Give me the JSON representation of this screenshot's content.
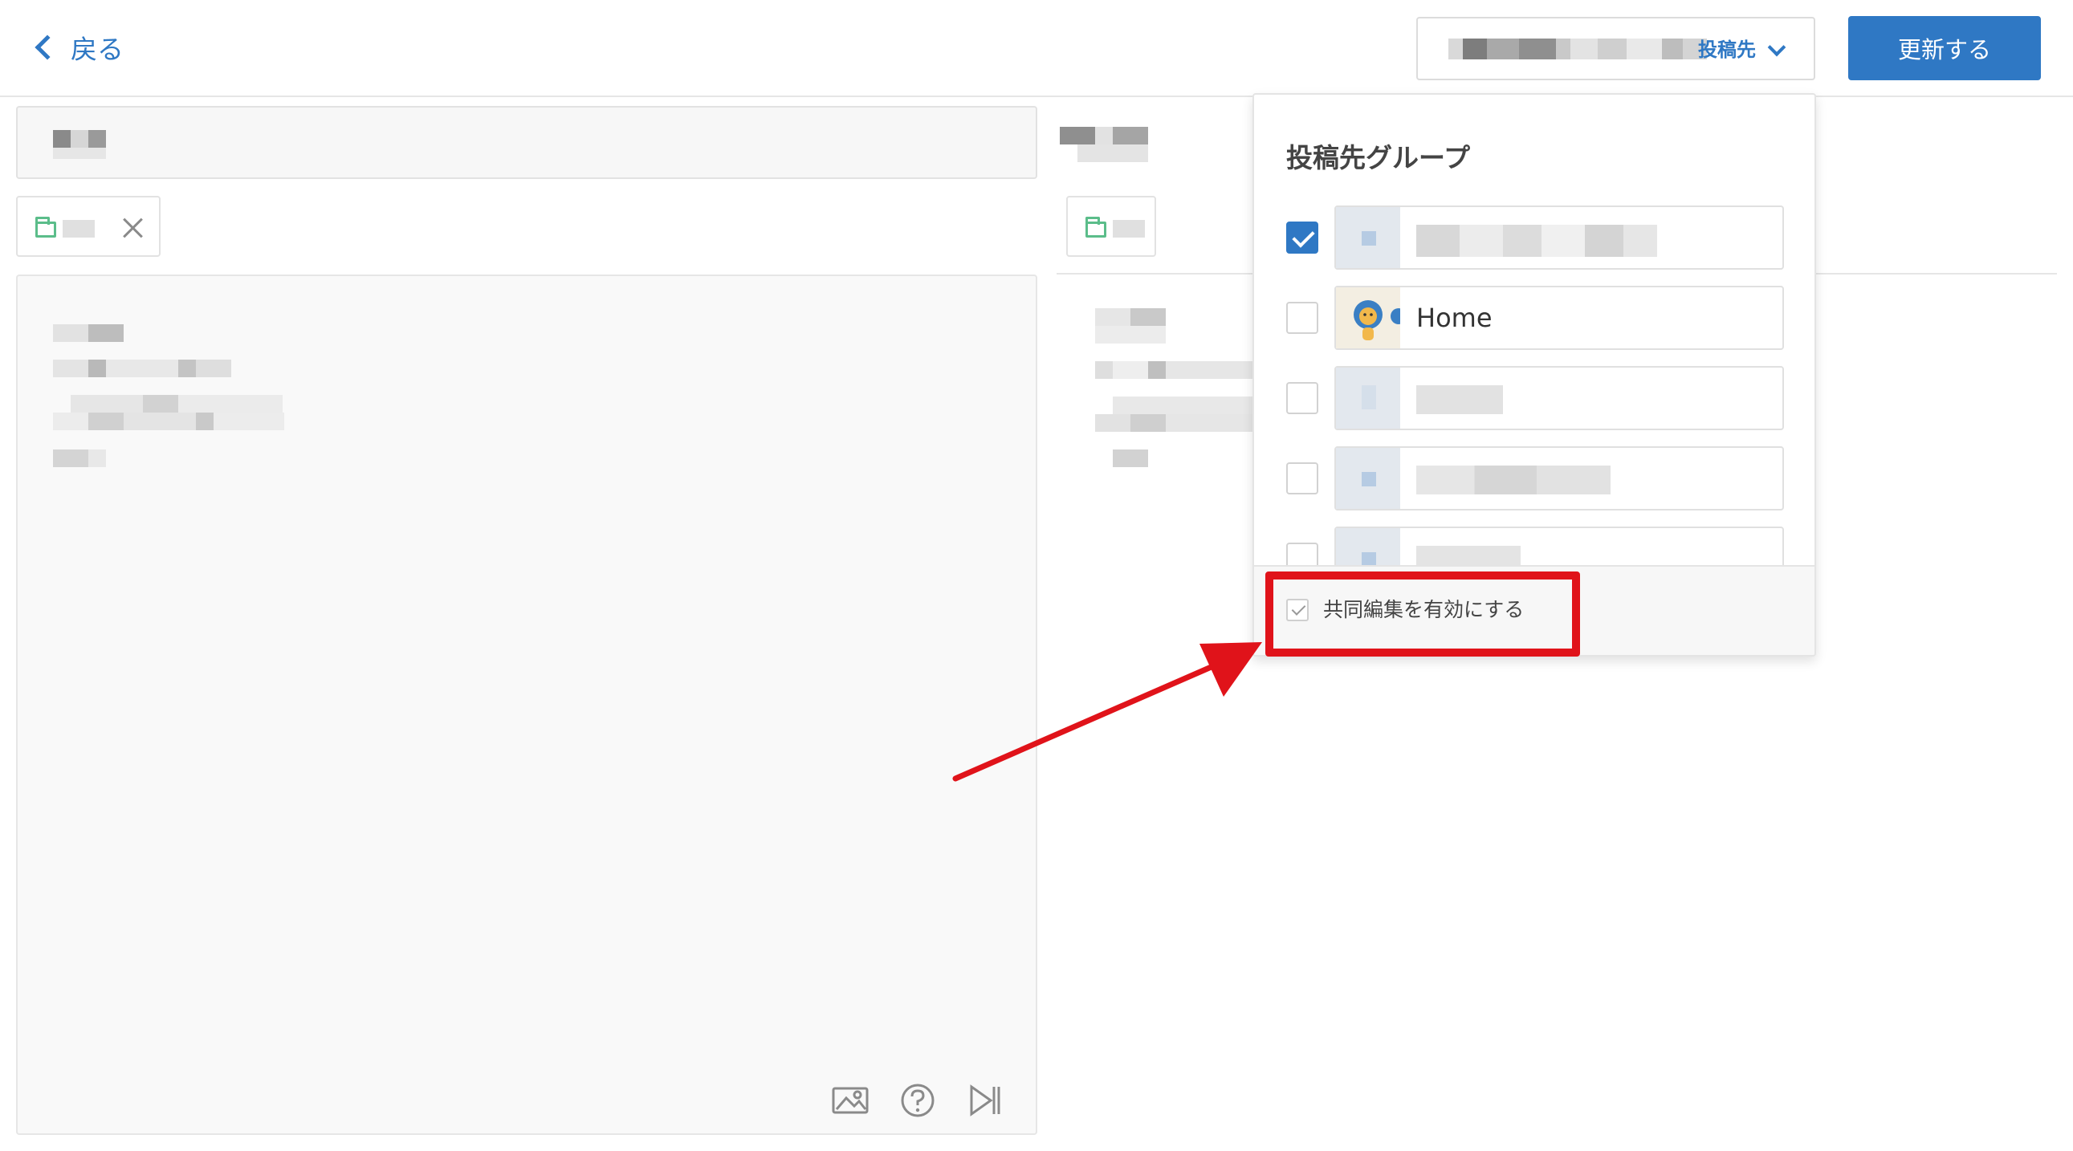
{
  "header": {
    "back_label": "戻る",
    "destination_label": "投稿先",
    "update_label": "更新する"
  },
  "editor": {
    "toolbar_icons": [
      "image-icon",
      "help-icon",
      "preview-toggle-icon"
    ]
  },
  "dropdown": {
    "title": "投稿先グループ",
    "groups": [
      {
        "name": "",
        "checked": true
      },
      {
        "name": "Home",
        "checked": false
      },
      {
        "name": "",
        "checked": false
      },
      {
        "name": "",
        "checked": false
      },
      {
        "name": "",
        "checked": false
      }
    ],
    "collab_label": "共同編集を有効にする"
  },
  "colors": {
    "accent": "#2f78c4",
    "annotation": "#e0131a",
    "folder": "#5bbd8a"
  }
}
